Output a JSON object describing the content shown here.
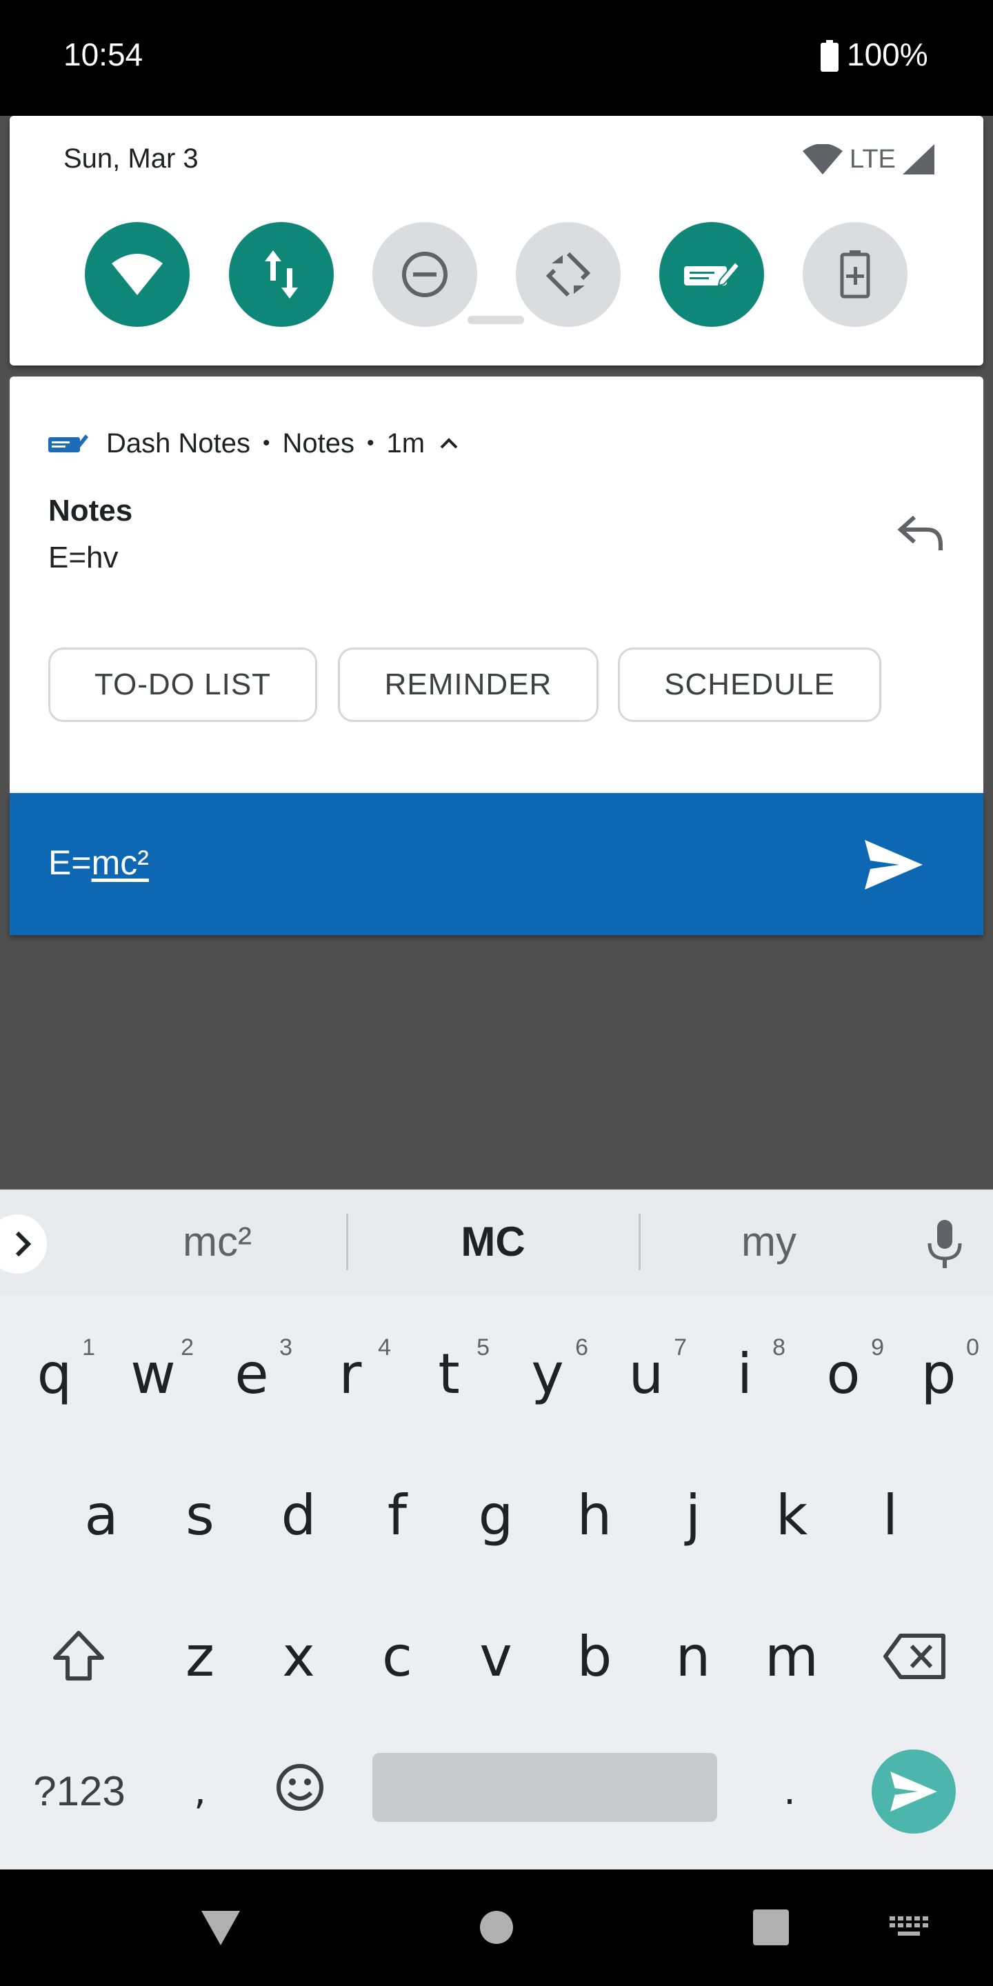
{
  "status_bar": {
    "time": "10:54",
    "battery": "100%"
  },
  "quick_settings": {
    "date": "Sun, Mar 3",
    "network": "LTE",
    "tiles": [
      {
        "icon": "wifi-icon",
        "on": true
      },
      {
        "icon": "mobile-data-icon",
        "on": true
      },
      {
        "icon": "do-not-disturb-icon",
        "on": false
      },
      {
        "icon": "auto-rotate-icon",
        "on": false
      },
      {
        "icon": "dash-notes-icon",
        "on": true
      },
      {
        "icon": "battery-saver-icon",
        "on": false
      }
    ]
  },
  "notification": {
    "app": "Dash Notes",
    "channel": "Notes",
    "time": "1m",
    "title": "Notes",
    "text": "E=hv",
    "actions": [
      "TO-DO LIST",
      "REMINDER",
      "SCHEDULE"
    ]
  },
  "reply": {
    "prefix": "E=",
    "underlined": "mc²"
  },
  "keyboard": {
    "suggestions": [
      "mc²",
      "MC",
      "my"
    ],
    "row1": [
      [
        "q",
        "1"
      ],
      [
        "w",
        "2"
      ],
      [
        "e",
        "3"
      ],
      [
        "r",
        "4"
      ],
      [
        "t",
        "5"
      ],
      [
        "y",
        "6"
      ],
      [
        "u",
        "7"
      ],
      [
        "i",
        "8"
      ],
      [
        "o",
        "9"
      ],
      [
        "p",
        "0"
      ]
    ],
    "row2": [
      "a",
      "s",
      "d",
      "f",
      "g",
      "h",
      "j",
      "k",
      "l"
    ],
    "row3": [
      "z",
      "x",
      "c",
      "v",
      "b",
      "n",
      "m"
    ],
    "symbols_key": "?123",
    "comma": ",",
    "period": "."
  },
  "colors": {
    "accent_teal": "#0f8778",
    "reply_blue": "#0d67b3",
    "send_key": "#4db6ac"
  }
}
